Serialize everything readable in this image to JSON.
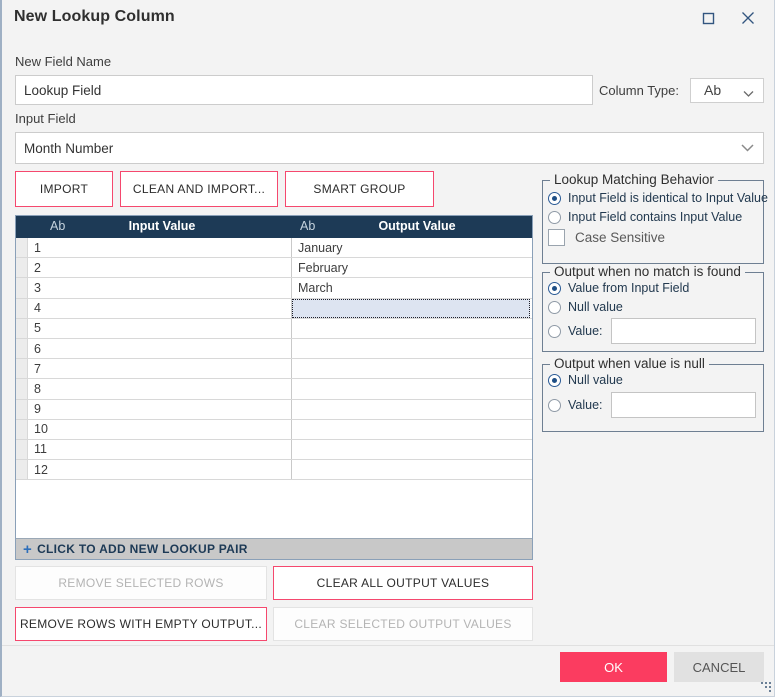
{
  "window": {
    "title": "New Lookup Column",
    "controls": [
      {
        "name": "maximize",
        "icon": "maximize-icon"
      },
      {
        "name": "close",
        "icon": "close-icon"
      }
    ]
  },
  "form": {
    "new_field_name_label": "New Field Name",
    "new_field_name_value": "Lookup Field",
    "column_type_label": "Column Type:",
    "column_type_value": "Ab",
    "input_field_label": "Input Field",
    "input_field_value": "Month Number"
  },
  "toolbar": {
    "import_label": "IMPORT",
    "clean_and_import_label": "CLEAN AND IMPORT...",
    "smart_group_label": "SMART GROUP"
  },
  "table": {
    "columns": [
      {
        "type_tag": "Ab",
        "header": "Input Value"
      },
      {
        "type_tag": "Ab",
        "header": "Output Value"
      }
    ],
    "rows": [
      {
        "input": "1",
        "output": "January"
      },
      {
        "input": "2",
        "output": "February"
      },
      {
        "input": "3",
        "output": "March"
      },
      {
        "input": "4",
        "output": ""
      },
      {
        "input": "5",
        "output": ""
      },
      {
        "input": "6",
        "output": ""
      },
      {
        "input": "7",
        "output": ""
      },
      {
        "input": "8",
        "output": ""
      },
      {
        "input": "9",
        "output": ""
      },
      {
        "input": "10",
        "output": ""
      },
      {
        "input": "11",
        "output": ""
      },
      {
        "input": "12",
        "output": ""
      }
    ],
    "selected_row_index": 3,
    "add_row_label": "CLICK TO ADD NEW LOOKUP PAIR",
    "add_row_plus": "+"
  },
  "row_actions": {
    "remove_selected_rows": "REMOVE SELECTED ROWS",
    "clear_all_output_values": "CLEAR ALL OUTPUT VALUES",
    "remove_rows_with_empty_output": "REMOVE ROWS WITH EMPTY OUTPUT...",
    "clear_selected_output_values": "CLEAR SELECTED OUTPUT VALUES"
  },
  "matching_behavior": {
    "legend": "Lookup Matching Behavior",
    "option_identical": "Input Field is identical to Input Value",
    "option_contains": "Input Field contains Input Value",
    "case_sensitive_label": "Case Sensitive"
  },
  "no_match": {
    "legend": "Output when no match is found",
    "option_value_from_input": "Value from Input Field",
    "option_null": "Null value",
    "option_value_label": "Value:",
    "value_input": ""
  },
  "value_null": {
    "legend": "Output when value is null",
    "option_null": "Null value",
    "option_value_label": "Value:",
    "value_input": ""
  },
  "footer": {
    "ok_label": "OK",
    "cancel_label": "CANCEL"
  },
  "colors": {
    "accent_pink": "#fb3c60",
    "header_navy": "#1d3a56",
    "selection_blue": "#dde4f1",
    "border_blue": "#8aa0b8"
  }
}
